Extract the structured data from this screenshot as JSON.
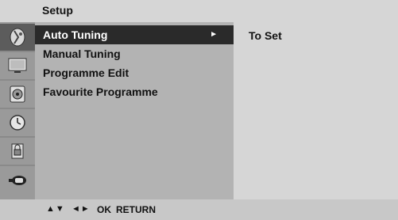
{
  "header": {
    "title": "Setup"
  },
  "sidebar": {
    "items": [
      {
        "icon": "tuning-antenna-icon",
        "active": true
      },
      {
        "icon": "monitor-picture-icon",
        "active": false
      },
      {
        "icon": "speaker-sound-icon",
        "active": false
      },
      {
        "icon": "clock-time-icon",
        "active": false
      },
      {
        "icon": "lock-option-icon",
        "active": false
      },
      {
        "icon": "input-source-icon",
        "active": false
      }
    ]
  },
  "menu": {
    "items": [
      {
        "label": "Auto Tuning",
        "arrow": "►"
      },
      {
        "label": "Manual Tuning"
      },
      {
        "label": "Programme Edit"
      },
      {
        "label": "Favourite Programme"
      }
    ]
  },
  "submenu": {
    "label": "To Set"
  },
  "footer": {
    "updown": "▲▼",
    "leftright": "◄►",
    "ok": "OK",
    "return": "RETURN"
  },
  "colors": {
    "selected_bg": "#2a2a2a",
    "sidebar_active": "#5c5c5c",
    "menu_bg": "#b3b3b3",
    "submenu_bg": "#d6d6d6"
  }
}
